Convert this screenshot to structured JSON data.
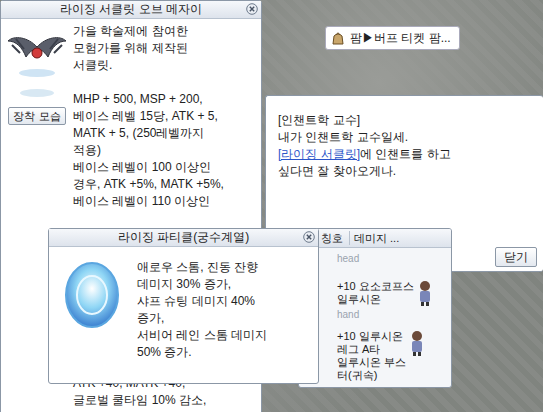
{
  "item_window": {
    "title": "라이징 서클릿 오브 메자이",
    "preview_button": "장착 모습",
    "intro": [
      "가을 학술제에 참여한",
      "모험가를 위해 제작된",
      "서클릿."
    ],
    "effects": [
      "MHP + 500, MSP + 200,",
      "베이스 레벨 15당, ATK + 5,",
      "MATK + 5, (250레벨까지",
      "적용)",
      "베이스 레벨이 100 이상인",
      "경우, ATK +5%, MATK +5%,",
      "베이스 레벨이 110 이상인"
    ],
    "effects_bottom": [
      "ATK +40, MATK +40,",
      "글로벌 쿨타임 10% 감소,"
    ]
  },
  "tooltip": {
    "title": "라이징 파티클(궁수계열)",
    "lines": [
      "애로우 스톰, 진동 잔향",
      "데미지 30% 증가,",
      "샤프 슈팅 데미지 40%",
      "증가,",
      "서비어 레인 스톰 데미지",
      "50% 증가."
    ]
  },
  "npc_label": {
    "text": "팜▶버프 티켓 팜..."
  },
  "dialog": {
    "speaker": "[인챈트학 교수]",
    "lines": [
      [
        {
          "text": "내가 인챈트학 교수일세.",
          "link": false
        }
      ],
      [
        {
          "text": "[라이징 서클릿]",
          "link": true
        },
        {
          "text": "에 인챈트를 하고",
          "link": false
        }
      ],
      [
        {
          "text": "싶다면 잘 찾아오게나.",
          "link": false
        }
      ]
    ],
    "close_button": "닫기"
  },
  "ranking": {
    "columns": [
      "칭호",
      "데미지 ..."
    ],
    "slots": [
      "head",
      "hand"
    ],
    "entries": [
      [
        "+10 요소코프스",
        "일루시온"
      ],
      [
        "+10 일루시온",
        "레그 A타",
        "일루시온 부스",
        "터(귀속)"
      ]
    ]
  }
}
